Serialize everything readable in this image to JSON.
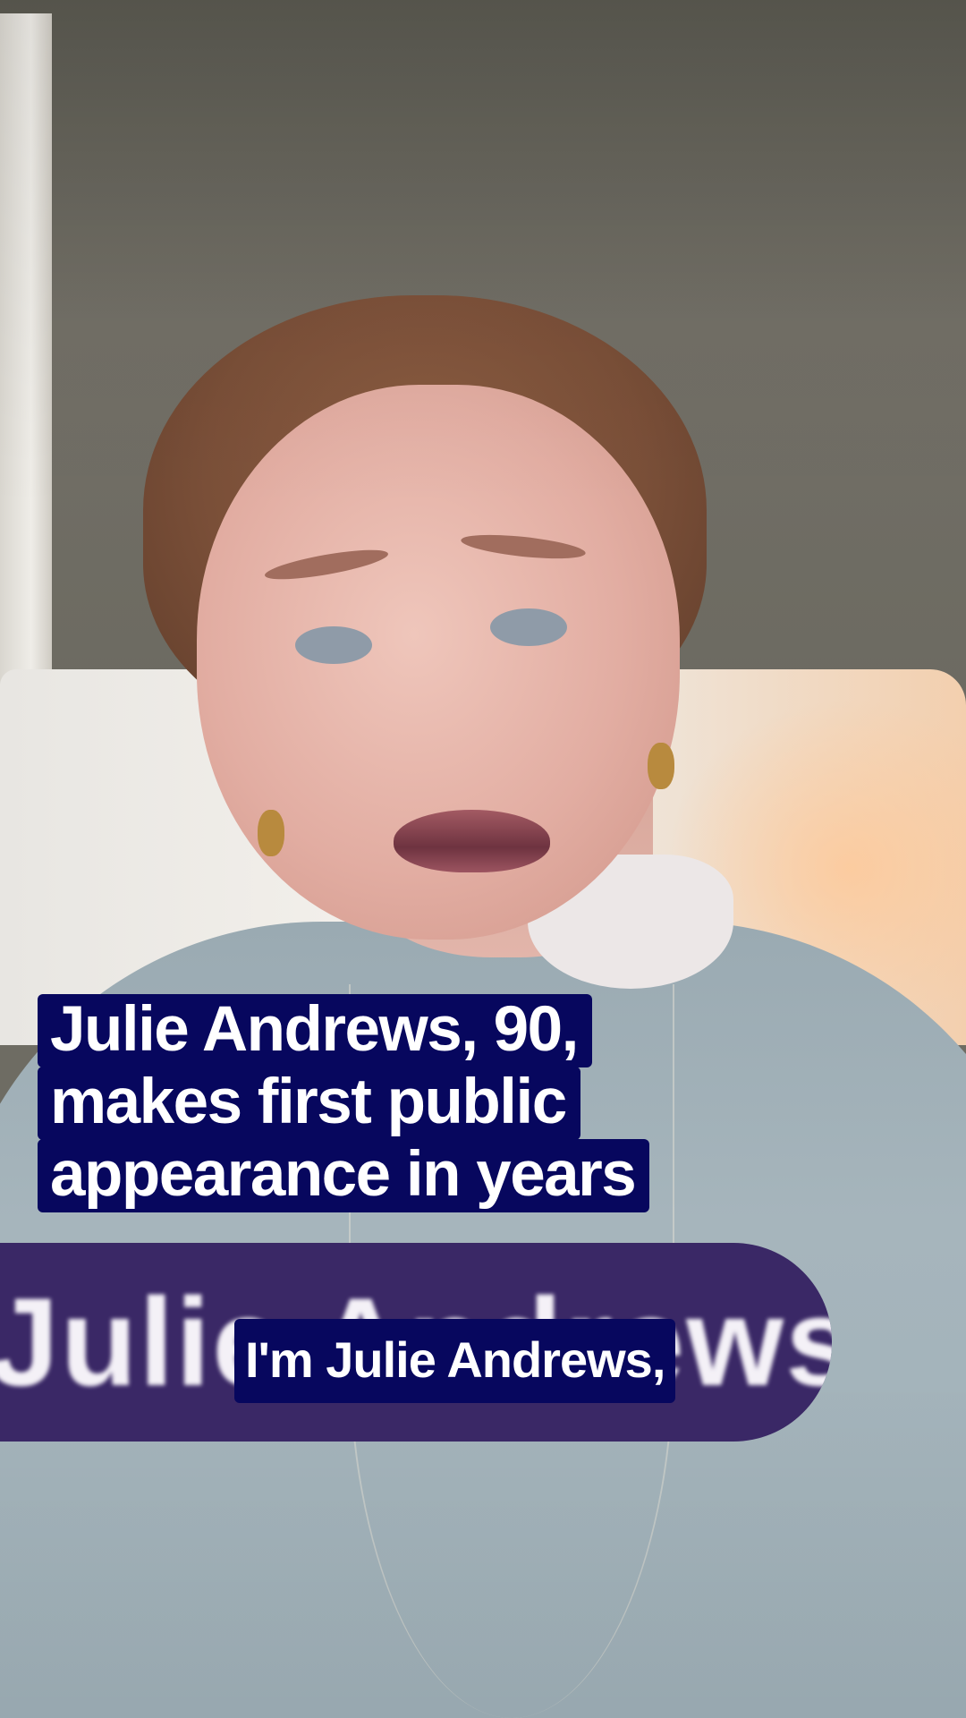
{
  "headline": {
    "lines": [
      "Julie Andrews, 90,",
      "makes first public",
      "appearance in years"
    ]
  },
  "name_banner": {
    "text": "Julie Andrews"
  },
  "caption": {
    "text": "I'm Julie Andrews,"
  },
  "colors": {
    "headline_background": "#07075e",
    "caption_background": "#07075e",
    "name_banner_background": "#3a2866",
    "text": "#ffffff"
  }
}
